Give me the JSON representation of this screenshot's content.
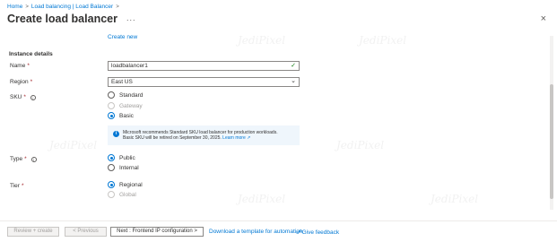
{
  "breadcrumb": {
    "home": "Home",
    "lb": "Load balancing | Load Balancer",
    "sep": ">"
  },
  "header": {
    "title": "Create load balancer",
    "more": "...",
    "close": "×"
  },
  "form": {
    "create_new": "Create new",
    "section_title": "Instance details",
    "required_mark": "*",
    "info_glyph": "i",
    "name": {
      "label": "Name",
      "value": "loadbalancer1",
      "valid_mark": "✓"
    },
    "region": {
      "label": "Region",
      "value": "East US",
      "chevron": "⌄"
    },
    "sku": {
      "label": "SKU",
      "options": [
        "Standard",
        "Gateway",
        "Basic"
      ],
      "selected": "Basic"
    },
    "sku_info": {
      "text1": "Microsoft recommends Standard SKU load balancer for production workloads.",
      "text2": "Basic SKU will be retired on September 30, 2025.",
      "link": "Learn more ↗"
    },
    "type": {
      "label": "Type",
      "options": [
        "Public",
        "Internal"
      ],
      "selected": "Public"
    },
    "tier": {
      "label": "Tier",
      "options": [
        "Regional",
        "Global"
      ],
      "selected": "Regional"
    }
  },
  "footer": {
    "review_create": "Review + create",
    "previous": "< Previous",
    "next": "Next : Frontend IP configuration >",
    "download_template": "Download a template for automation",
    "feedback": "Give feedback"
  },
  "colors": {
    "accent": "#0078d4",
    "required": "#a4262c",
    "valid": "#107c10",
    "info_bg": "#eff6fc"
  },
  "watermark": "JediPixel"
}
